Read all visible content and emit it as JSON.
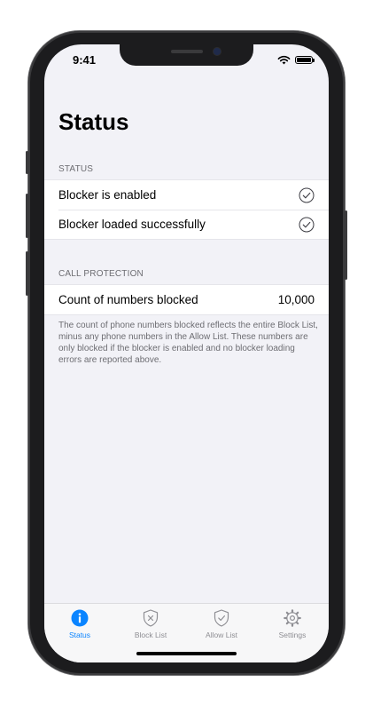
{
  "status_bar": {
    "time": "9:41"
  },
  "page": {
    "title": "Status"
  },
  "sections": {
    "status": {
      "header": "STATUS",
      "rows": [
        {
          "label": "Blocker is enabled",
          "icon": "checkmark-circle-icon"
        },
        {
          "label": "Blocker loaded successfully",
          "icon": "checkmark-circle-icon"
        }
      ]
    },
    "call_protection": {
      "header": "CALL PROTECTION",
      "row": {
        "label": "Count of numbers blocked",
        "value": "10,000"
      },
      "footer": "The count of phone numbers blocked reflects the entire Block List, minus any phone numbers in the Allow List. These numbers are only blocked if the blocker is enabled and no blocker loading errors are reported above."
    }
  },
  "tab_bar": {
    "tabs": [
      {
        "label": "Status",
        "icon": "info-icon",
        "active": true
      },
      {
        "label": "Block List",
        "icon": "shield-x-icon",
        "active": false
      },
      {
        "label": "Allow List",
        "icon": "shield-check-icon",
        "active": false
      },
      {
        "label": "Settings",
        "icon": "gear-icon",
        "active": false
      }
    ]
  },
  "colors": {
    "accent": "#0a84ff",
    "background": "#f2f2f7",
    "secondary_text": "#6d6d72",
    "inactive_tab": "#8e8e93"
  }
}
